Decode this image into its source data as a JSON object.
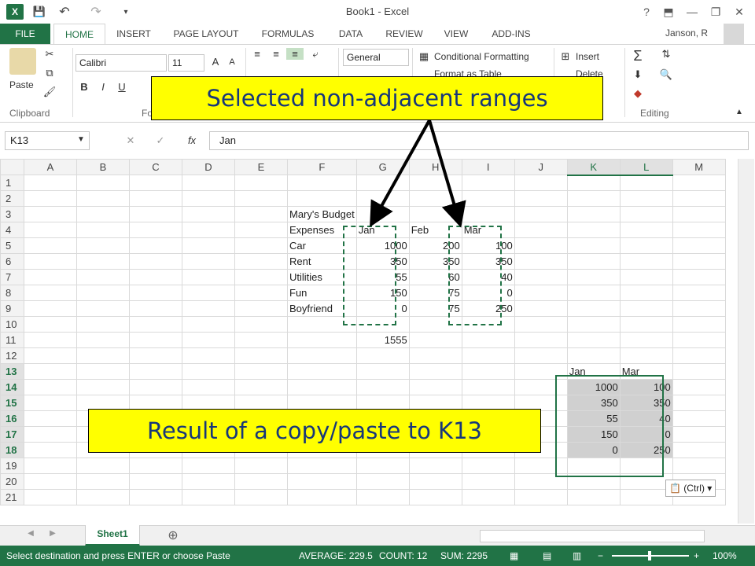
{
  "window": {
    "title": "Book1 - Excel",
    "user": "Janson, R",
    "help": "?",
    "minimize": "—",
    "restore": "❐",
    "close": "✕"
  },
  "quick_access": {
    "save": "💾",
    "undo": "↶",
    "redo": "↷"
  },
  "tabs": [
    "FILE",
    "HOME",
    "INSERT",
    "PAGE LAYOUT",
    "FORMULAS",
    "DATA",
    "REVIEW",
    "VIEW",
    "ADD-INS"
  ],
  "ribbon": {
    "clipboard": {
      "paste": "Paste",
      "label": "Clipboard"
    },
    "font": {
      "name": "Calibri",
      "size": "11",
      "bold": "B",
      "italic": "I",
      "underline": "U",
      "label": "Fo"
    },
    "number": {
      "format": "General"
    },
    "styles": {
      "conditional": "Conditional Formatting",
      "format_table": "Format as Table"
    },
    "cells": {
      "insert": "Insert",
      "delete": "Delete"
    },
    "editing": {
      "label": "Editing"
    }
  },
  "formula_bar": {
    "name_box": "K13",
    "cancel": "✕",
    "enter": "✓",
    "fx": "fx",
    "content": "Jan"
  },
  "columns": [
    "A",
    "B",
    "C",
    "D",
    "E",
    "F",
    "G",
    "H",
    "I",
    "J",
    "K",
    "L",
    "M"
  ],
  "selected_columns": [
    "K",
    "L"
  ],
  "rows": [
    "1",
    "2",
    "3",
    "4",
    "5",
    "6",
    "7",
    "8",
    "9",
    "10",
    "11",
    "12",
    "13",
    "14",
    "15",
    "16",
    "17",
    "18",
    "19",
    "20",
    "21"
  ],
  "selected_rows": [
    "13",
    "14",
    "15",
    "16",
    "17",
    "18"
  ],
  "cells": {
    "F3": "Mary's Budget",
    "F4": "Expenses",
    "G4": "Jan",
    "H4": "Feb",
    "I4": "Mar",
    "F5": "Car",
    "G5": "1000",
    "H5": "200",
    "I5": "100",
    "F6": "Rent",
    "G6": "350",
    "H6": "350",
    "I6": "350",
    "F7": "Utilities",
    "G7": "55",
    "H7": "60",
    "I7": "40",
    "F8": "Fun",
    "G8": "150",
    "H8": "75",
    "I8": "0",
    "F9": "Boyfriend",
    "G9": "0",
    "H9": "75",
    "I9": "250",
    "G11": "1555",
    "K13": "Jan",
    "L13": "Mar",
    "K14": "1000",
    "L14": "100",
    "K15": "350",
    "L15": "350",
    "K16": "55",
    "L16": "40",
    "K17": "150",
    "L17": "0",
    "K18": "0",
    "L18": "250"
  },
  "paste_options": "(Ctrl) ▾",
  "sheets": [
    "Sheet1"
  ],
  "add_sheet": "⊕",
  "status": {
    "message": "Select destination and press ENTER or choose Paste",
    "average": "AVERAGE: 229.5",
    "count": "COUNT: 12",
    "sum": "SUM: 2295",
    "zoom": "100%"
  },
  "annotations": {
    "top": "Selected non-adjacent ranges",
    "bottom": "Result of a copy/paste to K13"
  },
  "colors": {
    "excel_green": "#217346",
    "callout_bg": "#ffff00",
    "callout_text": "#17377a"
  }
}
